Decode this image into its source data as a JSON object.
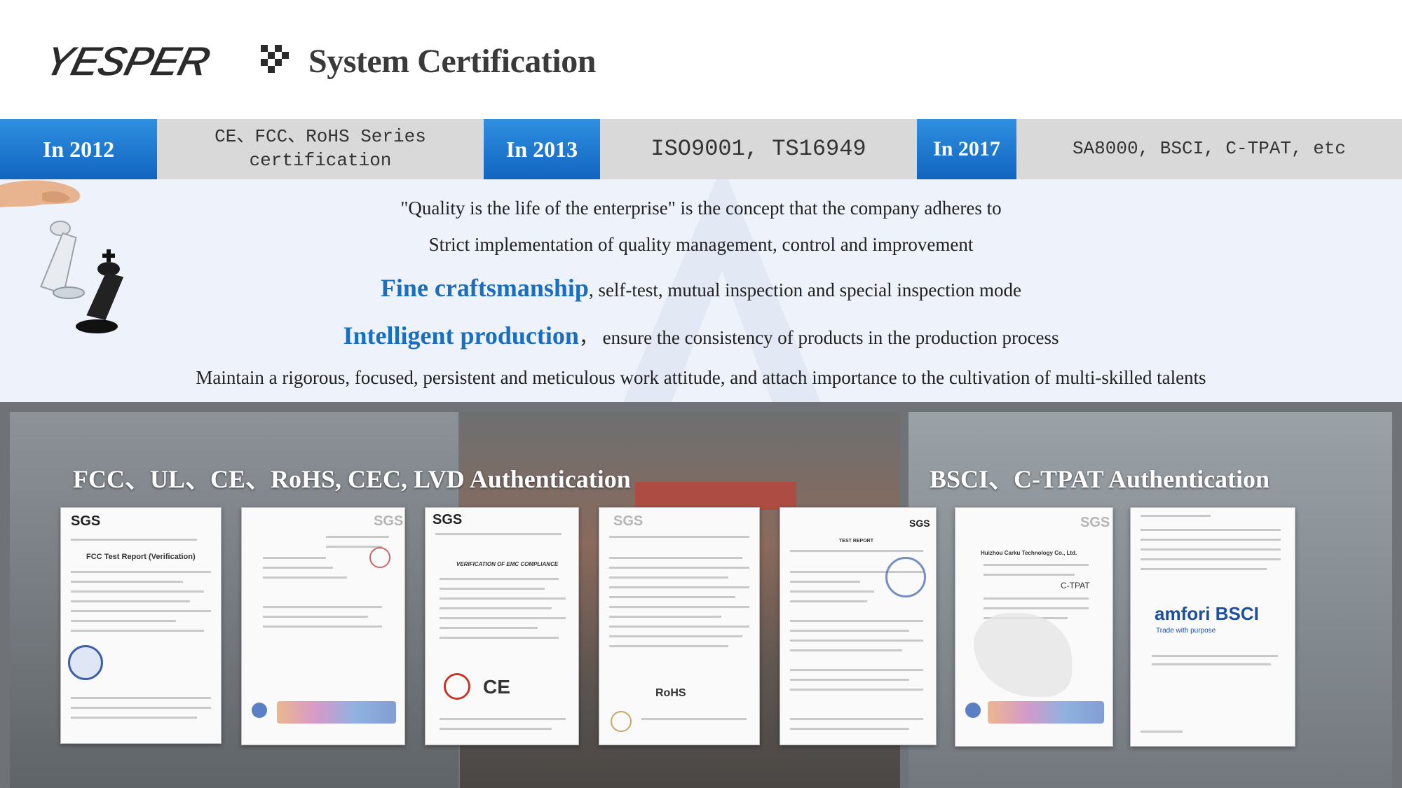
{
  "header": {
    "logo_text": "YESPER",
    "title": "System Certification"
  },
  "timeline": [
    {
      "year": "In 2012",
      "certs": "CE、FCC、RoHS Series certification"
    },
    {
      "year": "In 2013",
      "certs": "ISO9001, TS16949"
    },
    {
      "year": "In 2017",
      "certs": "SA8000, BSCI, C-TPAT, etc"
    }
  ],
  "statement": {
    "line1": "\"Quality is the life of the enterprise\" is the concept that the company adheres to",
    "line2": "Strict implementation of quality management, control and improvement",
    "line3_highlight": "Fine craftsmanship",
    "line3_rest": ", self-test, mutual inspection and special inspection mode",
    "line4_highlight": "Intelligent production",
    "line4_rest": "，  ensure the consistency of products in the production process",
    "line5": "Maintain a rigorous, focused, persistent and meticulous work attitude, and attach importance to the cultivation of multi-skilled talents"
  },
  "authentication": {
    "left_title": "FCC、UL、CE、RoHS, CEC, LVD Authentication",
    "right_title": "BSCI、C-TPAT Authentication"
  },
  "certificates": [
    {
      "logo": "SGS",
      "title": "FCC Test Report (Verification)",
      "mark": ""
    },
    {
      "logo": "SGS",
      "title": "",
      "mark": ""
    },
    {
      "logo": "SGS",
      "title": "VERIFICATION OF EMC COMPLIANCE",
      "mark": "CE"
    },
    {
      "logo": "SGS",
      "title": "",
      "mark": "RoHS"
    },
    {
      "logo": "SGS",
      "title": "TEST REPORT",
      "mark": ""
    },
    {
      "logo": "SGS",
      "title": "Huizhou Carku Technology Co., Ltd.",
      "mark": "C-TPAT"
    },
    {
      "logo": "amfori BSCI",
      "title": "Trade with purpose",
      "mark": ""
    }
  ],
  "colors": {
    "accent_blue": "#1a6ec0",
    "year_blue": "#1f7ad4",
    "strip_gray": "#d9d9d9",
    "panel_bg": "#eef2fa"
  }
}
